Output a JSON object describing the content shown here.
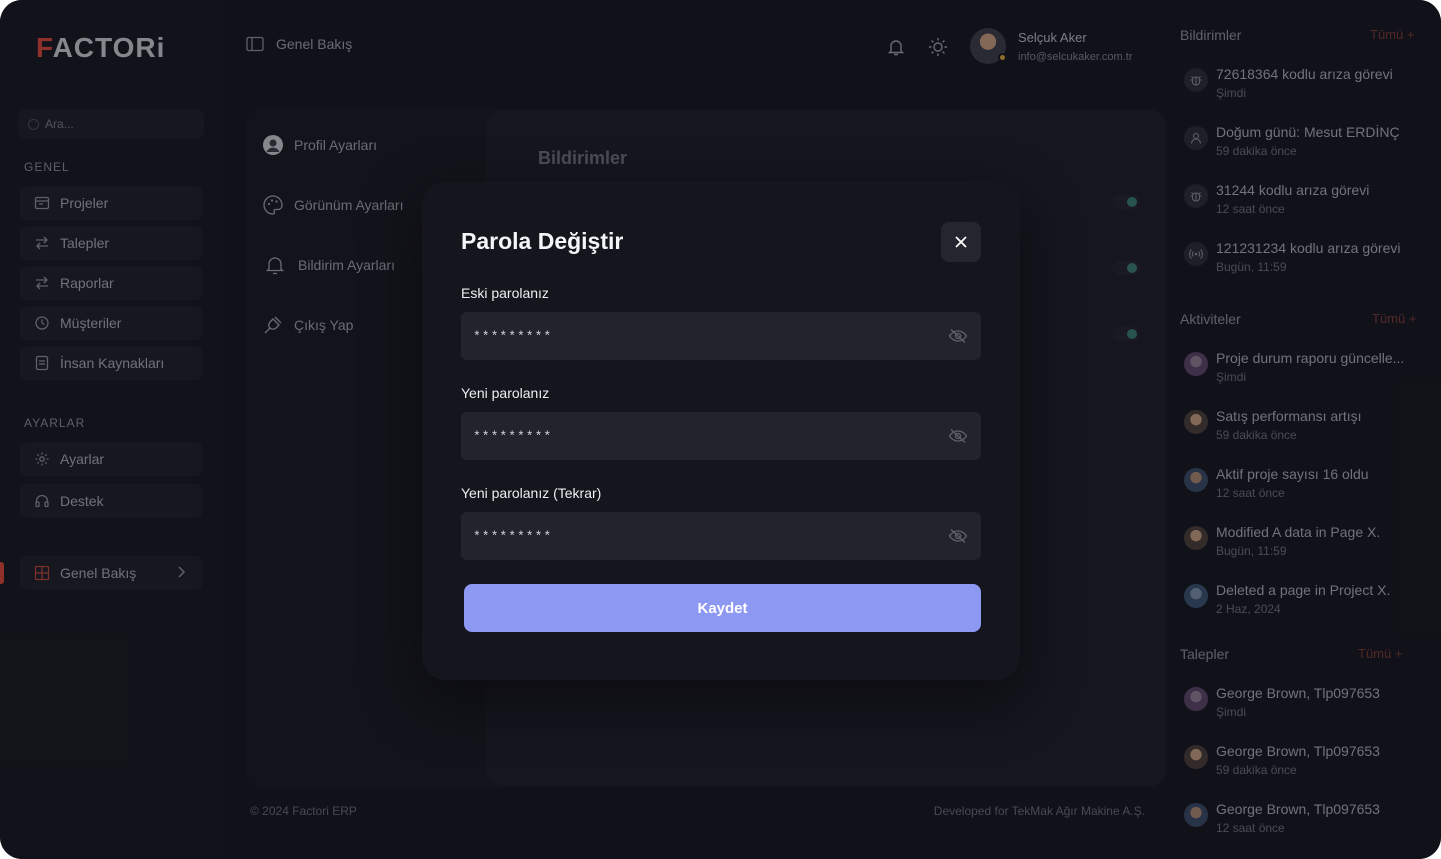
{
  "brand": {
    "logo_text_a": "F",
    "logo_text_b": "ACTOR",
    "logo_text_c": "i"
  },
  "sidebar": {
    "search_placeholder": "Ara...",
    "section_general": "GENEL",
    "section_settings": "AYARLAR",
    "general_items": [
      {
        "label": "Projeler",
        "icon": "projects-icon"
      },
      {
        "label": "Talepler",
        "icon": "requests-icon"
      },
      {
        "label": "Raporlar",
        "icon": "reports-icon"
      },
      {
        "label": "Müşteriler",
        "icon": "customers-icon"
      },
      {
        "label": "İnsan Kaynakları",
        "icon": "hr-icon"
      }
    ],
    "settings_items": [
      {
        "label": "Ayarlar",
        "icon": "gear-icon"
      },
      {
        "label": "Destek",
        "icon": "headset-icon"
      }
    ],
    "overview_item": {
      "label": "Genel Bakış",
      "icon": "grid-icon"
    }
  },
  "header": {
    "title": "Genel Bakış",
    "user_name": "Selçuk Aker",
    "user_email": "info@selcukaker.com.tr"
  },
  "settings": {
    "menu": [
      {
        "label": "Profil Ayarları",
        "icon": "user-icon"
      },
      {
        "label": "Görünüm Ayarları",
        "icon": "palette-icon"
      },
      {
        "label": "Bildirim Ayarları",
        "icon": "bell-icon"
      },
      {
        "label": "Çıkış Yap",
        "icon": "plug-icon"
      }
    ],
    "panel_title": "Bildirimler"
  },
  "footer": {
    "left": "© 2024 Factori ERP",
    "right": "Developed for TekMak Ağır Makine A.Ş."
  },
  "right_panel": {
    "notifications": {
      "title": "Bildirimler",
      "all_label": "Tümü +",
      "items": [
        {
          "title": "72618364 kodlu arıza görevi",
          "time": "Şimdi"
        },
        {
          "title": "Doğum günü: Mesut ERDİNÇ",
          "time": "59 dakika önce"
        },
        {
          "title": "31244 kodlu arıza görevi",
          "time": "12 saat önce"
        },
        {
          "title": "121231234 kodlu arıza görevi",
          "time": "Bugün, 11:59"
        }
      ]
    },
    "activities": {
      "title": "Aktiviteler",
      "all_label": "Tümü +",
      "items": [
        {
          "title": "Proje durum raporu güncelle...",
          "time": "Şimdi"
        },
        {
          "title": "Satış performansı artışı",
          "time": "59 dakika önce"
        },
        {
          "title": "Aktif proje sayısı 16 oldu",
          "time": "12 saat önce"
        },
        {
          "title": "Modified A data in Page X.",
          "time": "Bugün, 11:59"
        },
        {
          "title": "Deleted a page in Project X.",
          "time": "2 Haz, 2024"
        }
      ]
    },
    "requests": {
      "title": "Talepler",
      "all_label": "Tümü +",
      "items": [
        {
          "title": "George Brown, Tlp097653",
          "time": "Şimdi"
        },
        {
          "title": "George Brown, Tlp097653",
          "time": "59 dakika önce"
        },
        {
          "title": "George Brown, Tlp097653",
          "time": "12 saat önce"
        }
      ]
    }
  },
  "modal": {
    "title": "Parola Değiştir",
    "fields": [
      {
        "label": "Eski parolanız",
        "value": "*********"
      },
      {
        "label": "Yeni parolanız",
        "value": "*********"
      },
      {
        "label": "Yeni parolanız (Tekrar)",
        "value": "*********"
      }
    ],
    "save_label": "Kaydet"
  },
  "colors": {
    "accent": "#d8483a",
    "primary_button": "#8c98f1",
    "background": "#16171f",
    "toggle_on": "#3b7b6f"
  }
}
